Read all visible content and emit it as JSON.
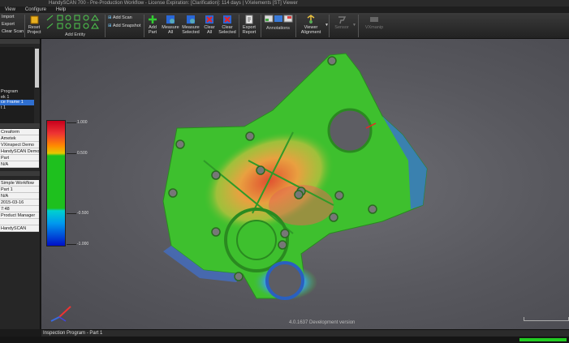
{
  "titlebar": {
    "text": "HandySCAN 700 - Pre-Production Workflow - License Expiration: [Clarification]: 114 days | VXelements [ST] Viewer"
  },
  "menu": [
    "View",
    "Configure",
    "Help"
  ],
  "ribbon": {
    "file_items": [
      "Import",
      "Export",
      "Clear Scan"
    ],
    "reset_project": "Reset Project",
    "add_entity": "Add Entity",
    "add_scan": "Add Scan",
    "add_snapshot": "Add Snapshot",
    "add_part": "Add Part",
    "measure_all": "Measure All",
    "measure_selected": "Measure Selected",
    "clear_all": "Clear All",
    "clear_selected": "Clear Selected",
    "export_report": "Export Report",
    "annotations": "Annotations",
    "viewer_alignment": "Viewer Alignment",
    "sensor": "Sensor",
    "vxmanip": "VXmanip"
  },
  "left_panel": {
    "tree": [
      "",
      "",
      "",
      "",
      "",
      "",
      "",
      "",
      "Program",
      "ek 1",
      "ce Frame 1",
      "t 1"
    ],
    "selected_index": 10,
    "table1": [
      "Creaform",
      "Ametek",
      "VXinspect Demo",
      "HandySCAN Demo",
      "Part",
      "N/A"
    ],
    "table2": [
      "Simple Workflow",
      "Part 1",
      "N/A",
      "2015-03-16",
      "7:48",
      "Product Manager",
      "",
      "HandySCAN"
    ]
  },
  "legend": {
    "labels": [
      "1.000",
      "0.500",
      "-0.500",
      "-1.000"
    ]
  },
  "viewport": {
    "version": "4.0.1637 Development version"
  },
  "status": {
    "text": "Inspection Program - Part 1"
  }
}
